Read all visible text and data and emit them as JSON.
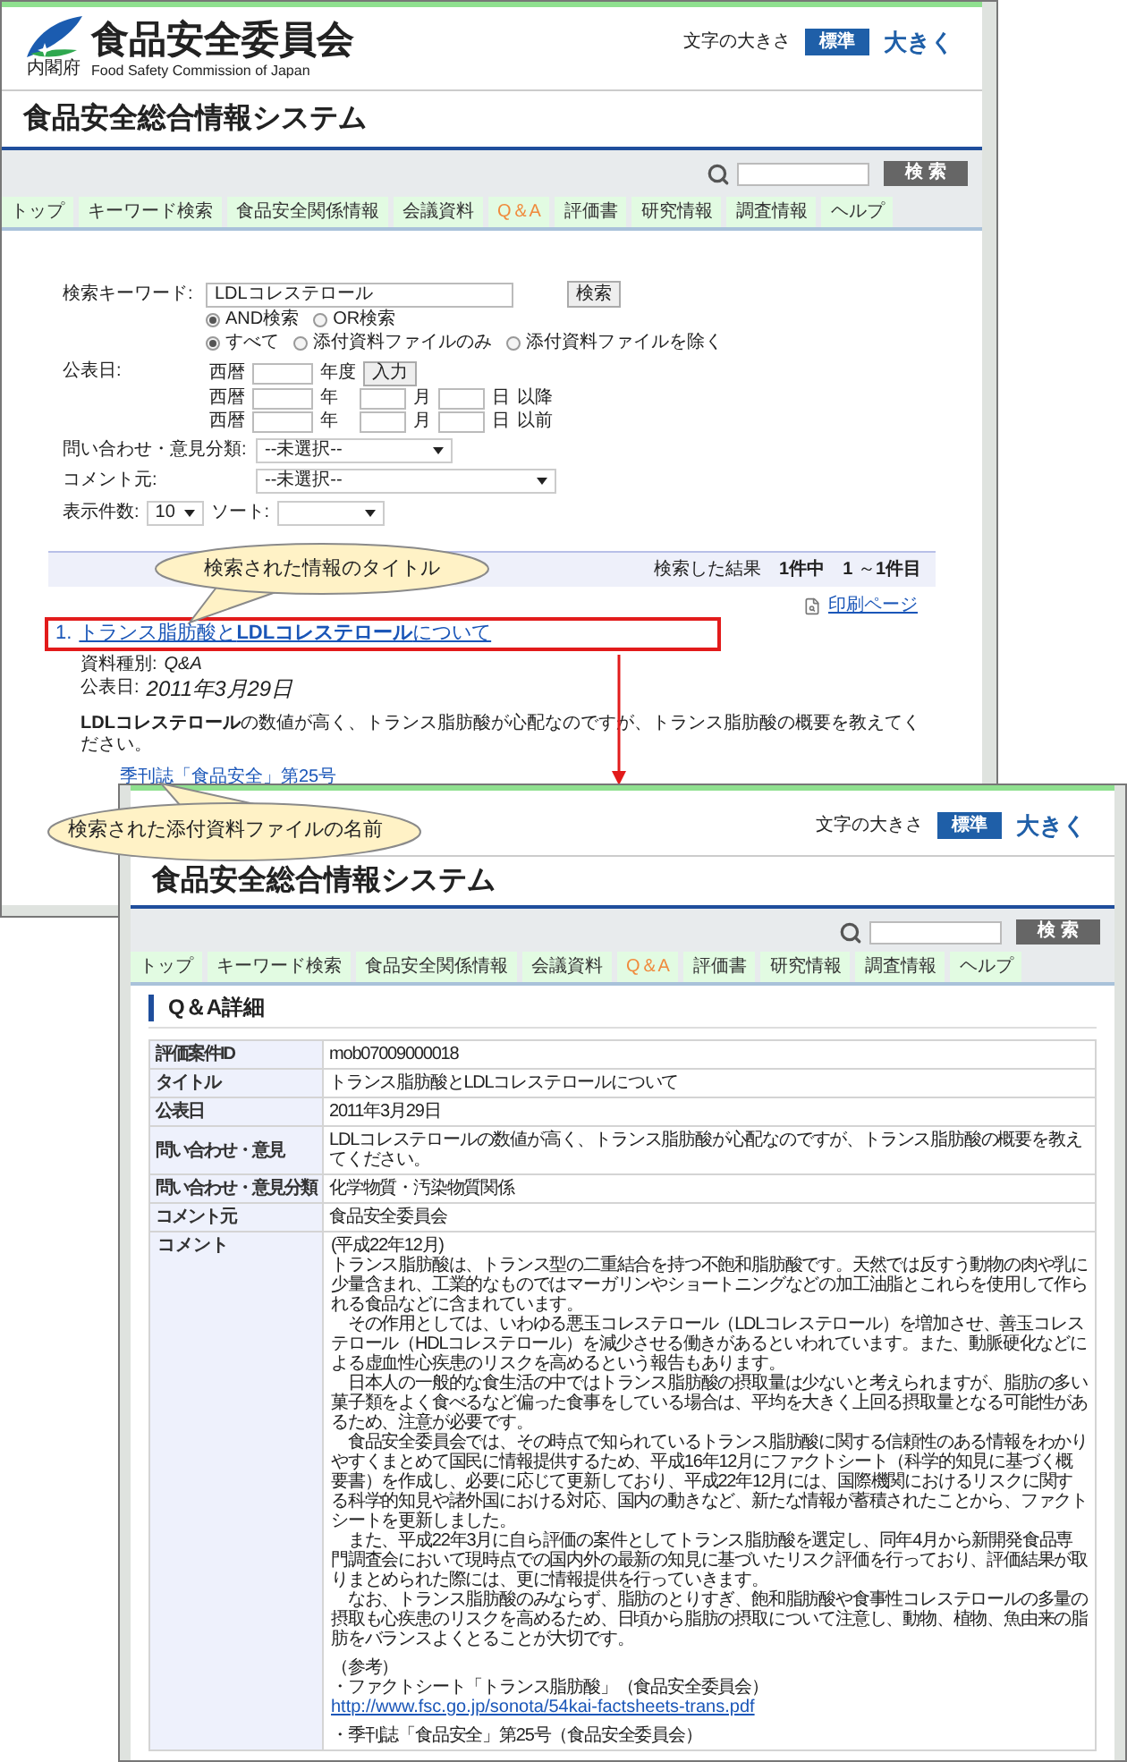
{
  "window1": {
    "header": {
      "ministry": "内閣府",
      "org_name": "食品安全委員会",
      "org_name_en": "Food Safety Commission of Japan",
      "font_size_label": "文字の大きさ",
      "font_size_options": [
        {
          "label": "標準",
          "selected": true
        },
        {
          "label": "大きく",
          "selected": false
        }
      ]
    },
    "system_title": "食品安全総合情報システム",
    "band": {
      "search_button": "検 索",
      "tabs": [
        {
          "label": "トップ",
          "selected": false
        },
        {
          "label": "キーワード検索",
          "selected": false
        },
        {
          "label": "食品安全関係情報",
          "selected": false
        },
        {
          "label": "会議資料",
          "selected": false
        },
        {
          "label": "Q＆A",
          "selected": true
        },
        {
          "label": "評価書",
          "selected": false
        },
        {
          "label": "研究情報",
          "selected": false
        },
        {
          "label": "調査情報",
          "selected": false
        },
        {
          "label": "ヘルプ",
          "selected": false
        }
      ]
    },
    "form": {
      "keyword_label": "検索キーワード:",
      "keyword_value": "LDLコレステロール",
      "search_button": "検索",
      "match_options": [
        {
          "label": "AND検索",
          "selected": true
        },
        {
          "label": "OR検索",
          "selected": false
        }
      ],
      "scope_options": [
        {
          "label": "すべて",
          "selected": true
        },
        {
          "label": "添付資料ファイルのみ",
          "selected": false
        },
        {
          "label": "添付資料ファイルを除く",
          "selected": false
        }
      ],
      "date_label": "公表日:",
      "fiscal_row": {
        "era": "西暦",
        "year_unit": "年度",
        "button": "入力"
      },
      "range_rows": [
        {
          "era": "西暦",
          "year_unit": "年",
          "month_unit": "月",
          "day_unit": "日",
          "suffix": "以降"
        },
        {
          "era": "西暦",
          "year_unit": "年",
          "month_unit": "月",
          "day_unit": "日",
          "suffix": "以前"
        }
      ],
      "category": {
        "label": "問い合わせ・意見分類:",
        "value": "--未選択--"
      },
      "comment_source": {
        "label": "コメント元:",
        "value": "--未選択--"
      },
      "count": {
        "label": "表示件数:",
        "value": "10"
      },
      "sort": {
        "label": "ソート:"
      }
    },
    "results": {
      "summary": "検索した結果　**1件中**　**1** ～**1件目**",
      "print_link": "印刷ページ",
      "items": [
        {
          "number": "1.",
          "title": "トランス脂肪酸と**LDLコレステロール**について",
          "type_label": "資料種別:",
          "type_value": "Q&A",
          "date_label": "公表日:",
          "date_value": "2011年3月29日",
          "description": "**LDLコレステロール**の数値が高く、トランス脂肪酸が心配なのですが、トランス脂肪酸の概要を教えてください。",
          "attachments": [
            "季刊誌「食品安全」第25号"
          ]
        }
      ]
    }
  },
  "window2": {
    "header": {
      "font_size_label": "文字の大きさ",
      "font_size_options": [
        {
          "label": "標準",
          "selected": true
        },
        {
          "label": "大きく",
          "selected": false
        }
      ]
    },
    "system_title": "食品安全総合情報システム",
    "band": {
      "search_button": "検 索",
      "tabs": [
        {
          "label": "トップ",
          "selected": false
        },
        {
          "label": "キーワード検索",
          "selected": false
        },
        {
          "label": "食品安全関係情報",
          "selected": false
        },
        {
          "label": "会議資料",
          "selected": false
        },
        {
          "label": "Q＆A",
          "selected": true
        },
        {
          "label": "評価書",
          "selected": false
        },
        {
          "label": "研究情報",
          "selected": false
        },
        {
          "label": "調査情報",
          "selected": false
        },
        {
          "label": "ヘルプ",
          "selected": false
        }
      ]
    },
    "section_title": "Q＆A詳細",
    "detail_rows": [
      {
        "label": "評価案件ID",
        "value": "mob07009000018"
      },
      {
        "label": "タイトル",
        "value": "トランス脂肪酸とLDLコレステロールについて"
      },
      {
        "label": "公表日",
        "value": "2011年3月29日"
      },
      {
        "label": "問い合わせ・意見",
        "value": "LDLコレステロールの数値が高く、トランス脂肪酸が心配なのですが、トランス脂肪酸の概要を教えてください。"
      },
      {
        "label": "問い合わせ・意見分類",
        "value": "化学物質・汚染物質関係"
      },
      {
        "label": "コメント元",
        "value": "食品安全委員会"
      }
    ],
    "comment": {
      "label": "コメント",
      "paragraphs": [
        "(平成22年12月)",
        "トランス脂肪酸は、トランス型の二重結合を持つ不飽和脂肪酸です。天然では反すう動物の肉や乳に少量含まれ、工業的なものではマーガリンやショートニングなどの加工油脂とこれらを使用して作られる食品などに含まれています。",
        "　その作用としては、いわゆる悪玉コレステロール（LDLコレステロール）を増加させ、善玉コレステロール（HDLコレステロール）を減少させる働きがあるといわれています。また、動脈硬化などによる虚血性心疾患のリスクを高めるという報告もあります。",
        "　日本人の一般的な食生活の中ではトランス脂肪酸の摂取量は少ないと考えられますが、脂肪の多い菓子類をよく食べるなど偏った食事をしている場合は、平均を大きく上回る摂取量となる可能性があるため、注意が必要です。",
        "　食品安全委員会では、その時点で知られているトランス脂肪酸に関する信頼性のある情報をわかりやすくまとめて国民に情報提供するため、平成16年12月にファクトシート（科学的知見に基づく概要書）を作成し、必要に応じて更新しており、平成22年12月には、国際機関におけるリスクに関する科学的知見や諸外国における対応、国内の動きなど、新たな情報が蓄積されたことから、ファクトシートを更新しました。",
        "　また、平成22年3月に自ら評価の案件としてトランス脂肪酸を選定し、同年4月から新開発食品専門調査会において現時点での国内外の最新の知見に基づいたリスク評価を行っており、評価結果が取りまとめられた際には、更に情報提供を行っていきます。",
        "　なお、トランス脂肪酸のみならず、脂肪のとりすぎ、飽和脂肪酸や食事性コレステロールの多量の摂取も心疾患のリスクを高めるため、日頃から脂肪の摂取について注意し、動物、植物、魚由来の脂肪をバランスよくとることが大切です。"
      ],
      "references_heading": "（参考）",
      "references": [
        {
          "text": "・ファクトシート「トランス脂肪酸」（食品安全委員会）",
          "url": "http://www.fsc.go.jp/sonota/54kai-factsheets-trans.pdf"
        },
        {
          "text": "・季刊誌「食品安全」第25号（食品安全委員会）"
        }
      ]
    }
  },
  "callouts": [
    {
      "text": "検索された情報のタイトル"
    },
    {
      "text": "検索された添付資料ファイルの名前"
    }
  ]
}
